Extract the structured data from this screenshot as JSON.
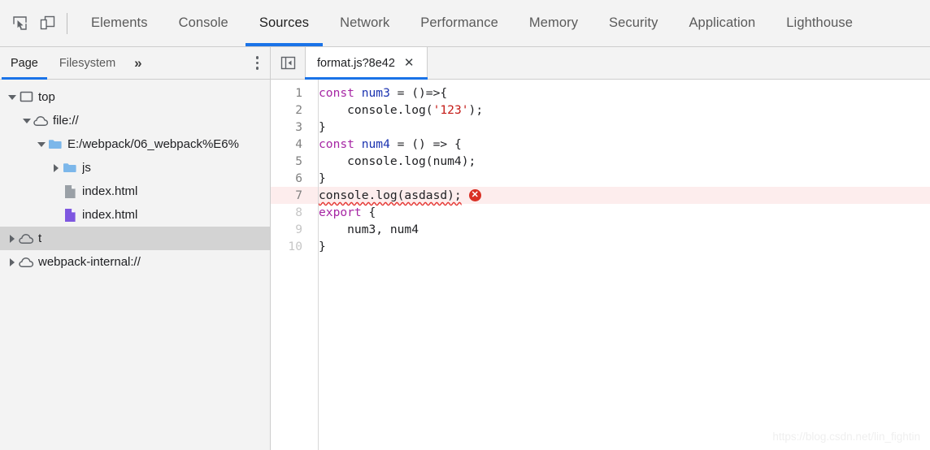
{
  "toolbar": {
    "inspect_icon": "inspect-cursor-icon",
    "device_icon": "device-toolbar-icon",
    "tabs": [
      {
        "label": "Elements",
        "active": false
      },
      {
        "label": "Console",
        "active": false
      },
      {
        "label": "Sources",
        "active": true
      },
      {
        "label": "Network",
        "active": false
      },
      {
        "label": "Performance",
        "active": false
      },
      {
        "label": "Memory",
        "active": false
      },
      {
        "label": "Security",
        "active": false
      },
      {
        "label": "Application",
        "active": false
      },
      {
        "label": "Lighthouse",
        "active": false
      }
    ]
  },
  "sidebar": {
    "tabs": [
      {
        "label": "Page",
        "active": true
      },
      {
        "label": "Filesystem",
        "active": false
      }
    ],
    "more_label": "»",
    "menu_icon": "kebab-menu-icon",
    "tree": [
      {
        "label": "top",
        "indent": 0,
        "twisty": "down",
        "icon": "frame",
        "selected": false
      },
      {
        "label": "file://",
        "indent": 1,
        "twisty": "down",
        "icon": "cloud",
        "selected": false
      },
      {
        "label": "E:/webpack/06_webpack%E6%",
        "indent": 2,
        "twisty": "down",
        "icon": "folder",
        "selected": false
      },
      {
        "label": "js",
        "indent": 3,
        "twisty": "right",
        "icon": "folder",
        "selected": false
      },
      {
        "label": "index.html",
        "indent": 3,
        "twisty": "none",
        "icon": "file-gray",
        "selected": false
      },
      {
        "label": "index.html",
        "indent": 3,
        "twisty": "none",
        "icon": "file-purple",
        "selected": false
      },
      {
        "label": "t",
        "indent": 0,
        "twisty": "right",
        "icon": "cloud",
        "selected": true
      },
      {
        "label": "webpack-internal://",
        "indent": 0,
        "twisty": "right",
        "icon": "cloud",
        "selected": false
      }
    ]
  },
  "editor": {
    "panel_toggle_icon": "show-navigator-icon",
    "file_tab": {
      "label": "format.js?8e42",
      "close_label": "✕"
    },
    "lines": [
      {
        "num": "1",
        "dim": false,
        "error": false,
        "tokens": [
          {
            "t": "const ",
            "c": "kw"
          },
          {
            "t": "num3",
            "c": "var"
          },
          {
            "t": " = ()=>{",
            "c": "pl"
          }
        ]
      },
      {
        "num": "2",
        "dim": false,
        "error": false,
        "tokens": [
          {
            "t": "    console.log(",
            "c": "pl"
          },
          {
            "t": "'123'",
            "c": "str"
          },
          {
            "t": ");",
            "c": "pl"
          }
        ]
      },
      {
        "num": "3",
        "dim": false,
        "error": false,
        "tokens": [
          {
            "t": "}",
            "c": "pl"
          }
        ]
      },
      {
        "num": "4",
        "dim": false,
        "error": false,
        "tokens": [
          {
            "t": "const ",
            "c": "kw"
          },
          {
            "t": "num4",
            "c": "var"
          },
          {
            "t": " = () => {",
            "c": "pl"
          }
        ]
      },
      {
        "num": "5",
        "dim": false,
        "error": false,
        "tokens": [
          {
            "t": "    console.log(num4);",
            "c": "pl"
          }
        ]
      },
      {
        "num": "6",
        "dim": false,
        "error": false,
        "tokens": [
          {
            "t": "}",
            "c": "pl"
          }
        ]
      },
      {
        "num": "7",
        "dim": false,
        "error": true,
        "badge": "✕",
        "tokens": [
          {
            "t": "console.log(asdasd);",
            "c": "pl",
            "squiggle": true
          }
        ]
      },
      {
        "num": "8",
        "dim": true,
        "error": false,
        "tokens": [
          {
            "t": "export",
            "c": "kw"
          },
          {
            "t": " {",
            "c": "pl"
          }
        ]
      },
      {
        "num": "9",
        "dim": true,
        "error": false,
        "tokens": [
          {
            "t": "    num3, num4",
            "c": "pl"
          }
        ]
      },
      {
        "num": "10",
        "dim": true,
        "error": false,
        "tokens": [
          {
            "t": "}",
            "c": "pl"
          }
        ]
      }
    ]
  },
  "watermark": {
    "text": "https://blog.csdn.net/lin_fightin"
  },
  "colors": {
    "accent": "#1a73e8",
    "error": "#d93025",
    "error_line_bg": "#fdeded",
    "chrome_bg": "#f3f3f3",
    "selection": "#d3d3d3",
    "keyword": "#a626a4",
    "variable": "#1b33b0",
    "string": "#c41a16"
  }
}
